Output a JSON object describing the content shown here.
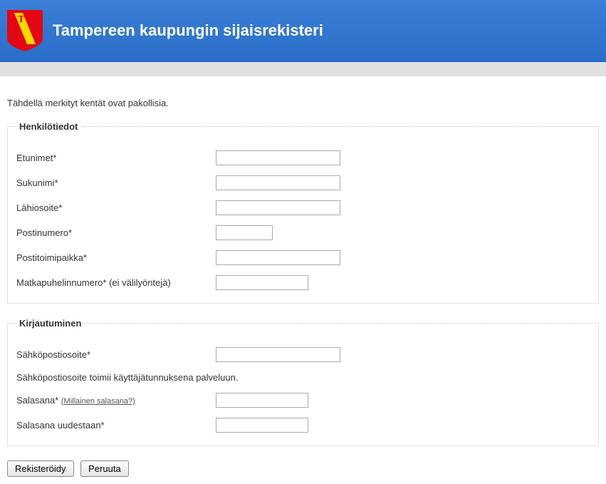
{
  "header": {
    "title": "Tampereen kaupungin sijaisrekisteri"
  },
  "intro": "Tähdellä merkityt kentät ovat pakollisia.",
  "fieldset1": {
    "legend": "Henkilötiedot",
    "fields": {
      "firstname": {
        "label": "Etunimet*",
        "value": ""
      },
      "lastname": {
        "label": "Sukunimi*",
        "value": ""
      },
      "address": {
        "label": "Lähiosoite*",
        "value": ""
      },
      "postalcode": {
        "label": "Postinumero*",
        "value": ""
      },
      "city": {
        "label": "Postitoimipaikka*",
        "value": ""
      },
      "mobile": {
        "label": "Matkapuhelinnumero* (ei välilyöntejä)",
        "value": ""
      }
    }
  },
  "fieldset2": {
    "legend": "Kirjautuminen",
    "fields": {
      "email": {
        "label": "Sähköpostiosoite*",
        "value": ""
      },
      "email_info": "Sähköpostiosoite toimii käyttäjätunnuksena palveluun.",
      "password": {
        "label": "Salasana* ",
        "hint": "(Millainen salasana?)",
        "value": ""
      },
      "password_confirm": {
        "label": "Salasana uudestaan*",
        "value": ""
      }
    }
  },
  "buttons": {
    "register": "Rekisteröidy",
    "cancel": "Peruuta"
  }
}
